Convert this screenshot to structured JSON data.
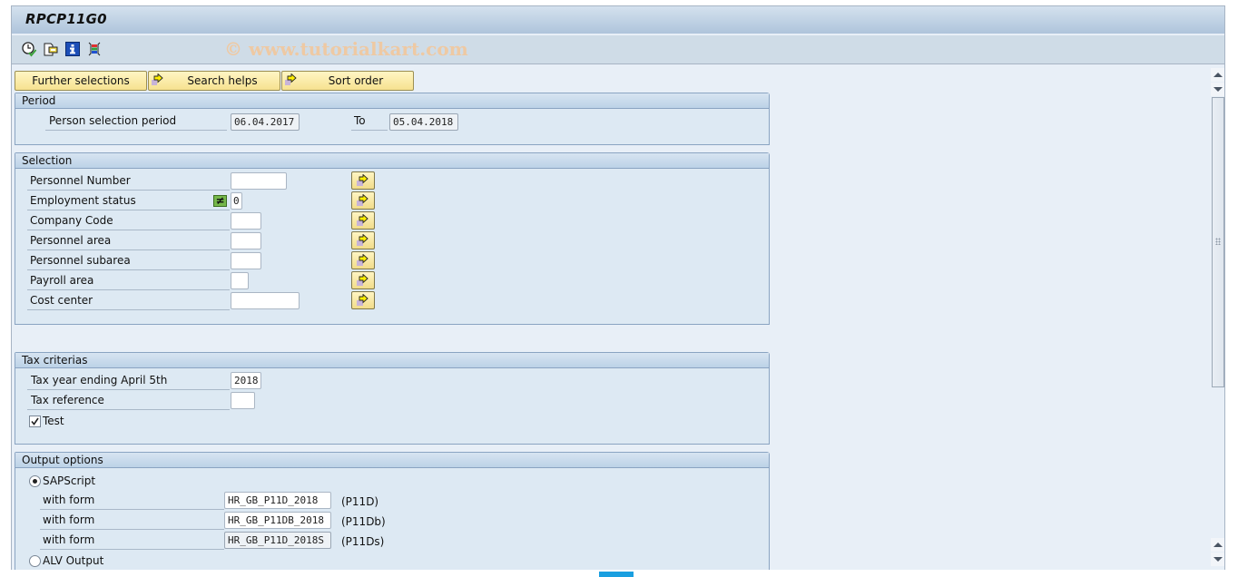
{
  "window": {
    "title": "RPCP11G0",
    "watermark": "© www.tutorialkart.com"
  },
  "toolbar": {
    "icons": [
      {
        "name": "execute-icon",
        "label": "Execute"
      },
      {
        "name": "get-variant-icon",
        "label": "Get Variant"
      },
      {
        "name": "info-icon",
        "label": "Program documentation"
      },
      {
        "name": "dynamic-selections-icon",
        "label": "Dynamic selections"
      }
    ]
  },
  "function_buttons": [
    {
      "label": "Further selections",
      "icon": null
    },
    {
      "label": "Search helps",
      "icon": "arrow-right-icon"
    },
    {
      "label": "Sort order",
      "icon": "arrow-right-icon"
    }
  ],
  "period": {
    "title": "Period",
    "label": "Person selection period",
    "from": "06.04.2017",
    "to_label": "To",
    "to": "05.04.2018"
  },
  "selection": {
    "title": "Selection",
    "fields": [
      {
        "label": "Personnel Number",
        "value": ""
      },
      {
        "label": "Employment status",
        "value": "0",
        "operator": "≠"
      },
      {
        "label": "Company Code",
        "value": ""
      },
      {
        "label": "Personnel area",
        "value": ""
      },
      {
        "label": "Personnel subarea",
        "value": ""
      },
      {
        "label": "Payroll area",
        "value": ""
      },
      {
        "label": "Cost center",
        "value": ""
      }
    ]
  },
  "tax": {
    "title": "Tax criterias",
    "year_label": "Tax year ending April 5th",
    "year_value": "2018",
    "ref_label": "Tax reference",
    "ref_value": "",
    "test_label": "Test",
    "test_checked": true
  },
  "output": {
    "title": "Output options",
    "sapscript_label": "SAPScript",
    "sapscript_selected": true,
    "forms": [
      {
        "label": "with form",
        "value": "HR_GB_P11D_2018",
        "suffix": "(P11D)"
      },
      {
        "label": "with form",
        "value": "HR_GB_P11DB_2018",
        "suffix": "(P11Db)"
      },
      {
        "label": "with form",
        "value": "HR_GB_P11D_2018S",
        "suffix": "(P11Ds)"
      }
    ],
    "alv_label": "ALV Output",
    "alv_selected": false
  }
}
